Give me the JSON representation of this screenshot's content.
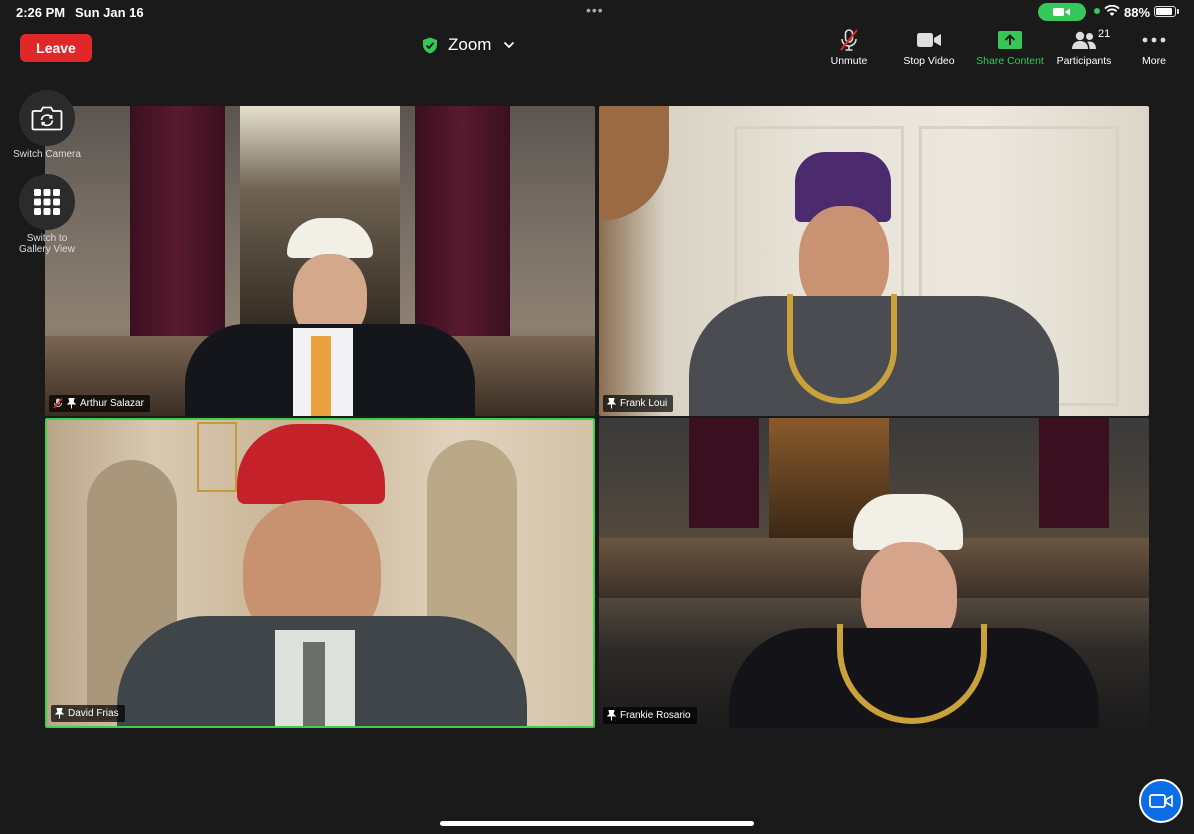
{
  "status_bar": {
    "time": "2:26 PM",
    "date": "Sun Jan 16",
    "battery_percent": "88%",
    "battery_level": 0.88,
    "multitask_indicator": "•••"
  },
  "header": {
    "leave_label": "Leave",
    "meeting_title": "Zoom",
    "colors": {
      "leave": "#e02828",
      "accent_green": "#35c759",
      "active_speaker_border": "#3fcf4b"
    }
  },
  "toolbar": {
    "unmute_label": "Unmute",
    "stop_video_label": "Stop Video",
    "share_content_label": "Share Content",
    "participants_label": "Participants",
    "participants_count": "21",
    "more_label": "More"
  },
  "side_controls": {
    "switch_camera_label": "Switch Camera",
    "gallery_view_label": "Switch to Gallery View"
  },
  "participants": [
    {
      "name": "Arthur Salazar",
      "muted": true,
      "pinned": true,
      "active_speaker": false
    },
    {
      "name": "Frank Loui",
      "muted": false,
      "pinned": true,
      "active_speaker": false
    },
    {
      "name": "David Frias",
      "muted": false,
      "pinned": true,
      "active_speaker": true
    },
    {
      "name": "Frankie Rosario",
      "muted": false,
      "pinned": true,
      "active_speaker": false
    }
  ]
}
